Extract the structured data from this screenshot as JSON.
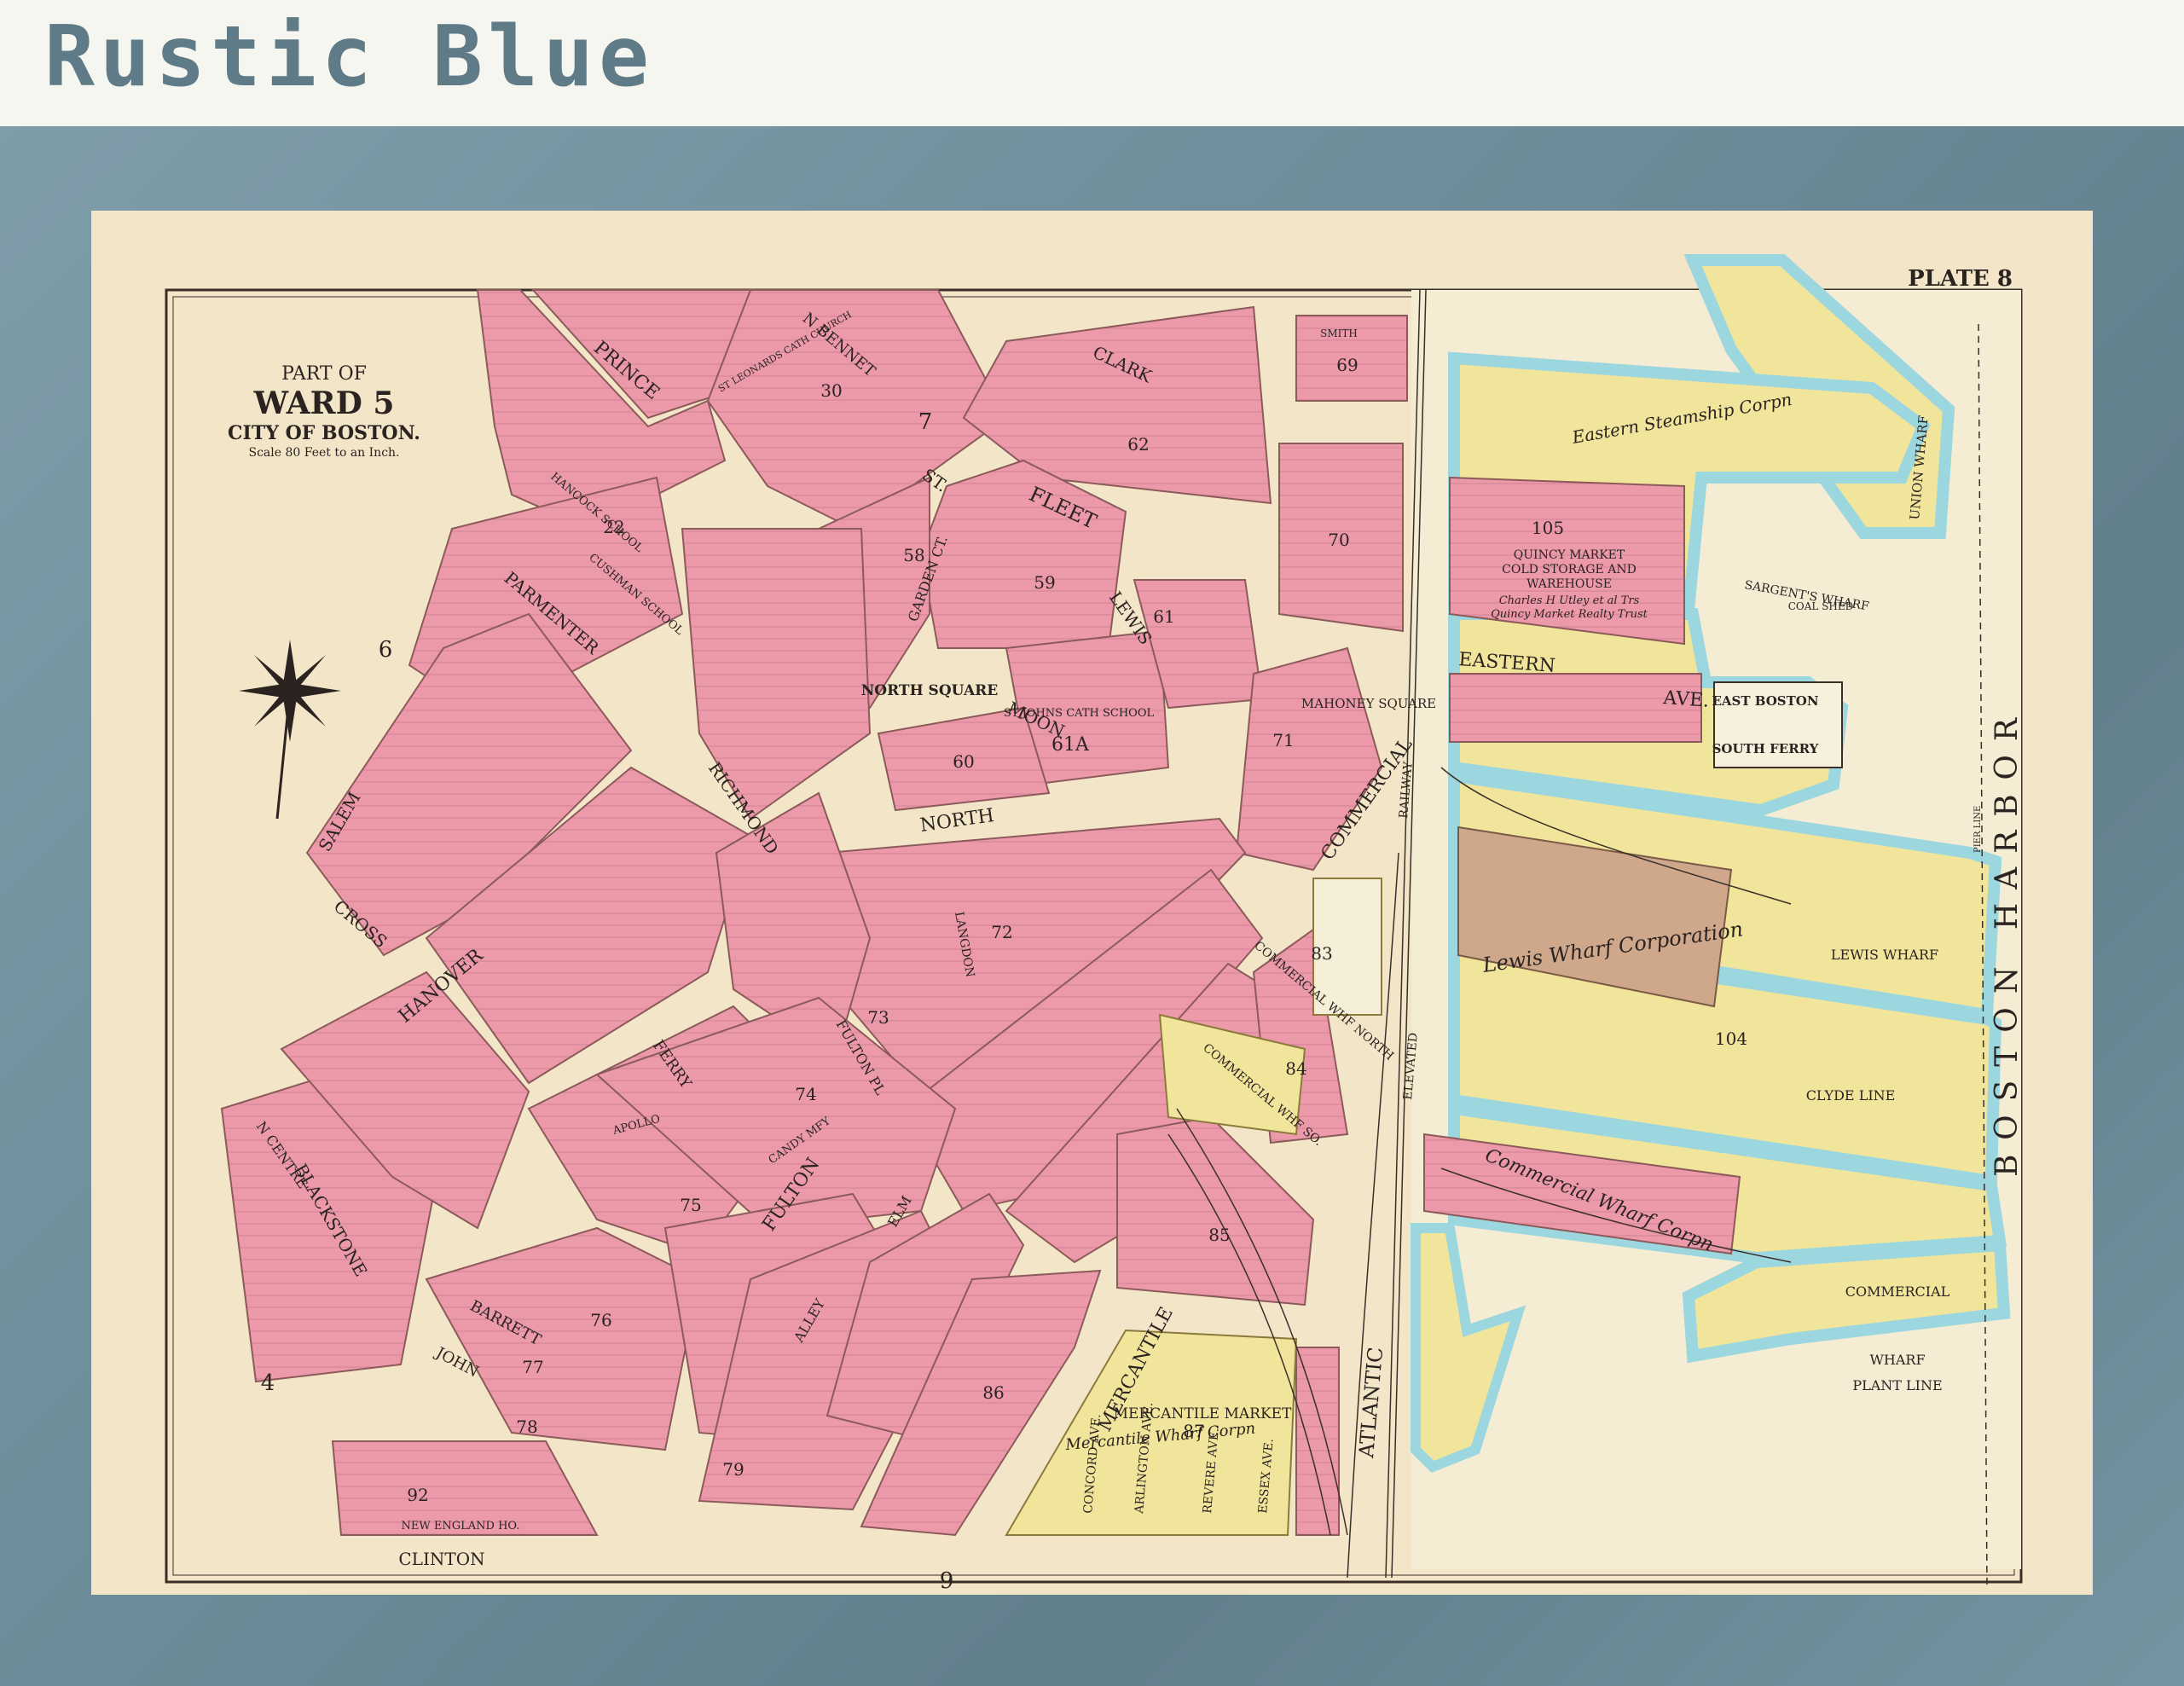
{
  "header": {
    "label": "Rustic Blue"
  },
  "map": {
    "plate": "PLATE 8",
    "title": {
      "line1": "PART OF",
      "line2": "WARD 5",
      "line3": "CITY OF BOSTON.",
      "scale": "Scale 80 Feet to an Inch."
    },
    "harbor_label": "BOSTON HARBOR",
    "section_numbers": [
      "7",
      "6",
      "4",
      "9"
    ],
    "block_numbers": [
      "62",
      "69",
      "70",
      "105",
      "61",
      "60",
      "61A",
      "71",
      "72",
      "83",
      "84",
      "85",
      "86",
      "87",
      "104",
      "73",
      "74",
      "75",
      "76",
      "77",
      "78",
      "79",
      "92",
      "22",
      "30",
      "58",
      "59"
    ],
    "streets": [
      "PRINCE",
      "N BENNET",
      "CLARK",
      "FLEET",
      "ST.",
      "MOON",
      "LEWIS",
      "GARDEN CT.",
      "NORTH SQUARE",
      "NORTH",
      "RICHMOND",
      "PARMENTER",
      "SALEM",
      "CROSS",
      "HANOVER",
      "FULTON",
      "COMMERCIAL",
      "EASTERN",
      "AVE.",
      "MAHONEY SQUARE",
      "ATLANTIC",
      "MERCANTILE",
      "CLINTON",
      "BLACKSTONE",
      "N CENTRE",
      "BARRETT",
      "JOHN",
      "FERRY",
      "ELM",
      "ALLEY",
      "FULTON PL",
      "CONCORD AVE.",
      "ARLINGTON AVE.",
      "REVERE AVE.",
      "ESSEX AVE.",
      "ELEVATED",
      "RAILWAY",
      "COMMERCIAL WHF NORTH",
      "COMMERCIAL WHF SO.",
      "LANGDON",
      "SMITH"
    ],
    "wharves": [
      "UNION WHARF",
      "Eastern Steamship Corpn",
      "SARGENT'S WHARF",
      "COAL SHED",
      "EAST BOSTON",
      "SOUTH FERRY",
      "LEWIS WHARF",
      "Lewis Wharf Corporation",
      "CLYDE LINE",
      "COMMERCIAL",
      "WHARF",
      "PLANT LINE",
      "Commercial Wharf Corpn",
      "MERCANTILE MARKET",
      "Mercantile Wharf Corpn",
      "PIER LINE"
    ],
    "buildings": [
      "QUINCY MARKET",
      "COLD STORAGE AND",
      "WAREHOUSE",
      "Charles H Utley et al Trs",
      "Quincy Market Realty Trust",
      "ST JOHNS CATH SCHOOL",
      "HANCOCK SCHOOL",
      "CUSHMAN SCHOOL",
      "ST LEONARDS CATH CHURCH",
      "NEW ENGLAND HO.",
      "APOLLO",
      "CANDY MFY"
    ],
    "colors": {
      "pink": "#ec9aaa",
      "yellow": "#f1e59b",
      "blue": "#9cd7df",
      "tan": "#cfa88c",
      "paper": "#f3e6c8",
      "street": "#f5ebd4"
    }
  }
}
